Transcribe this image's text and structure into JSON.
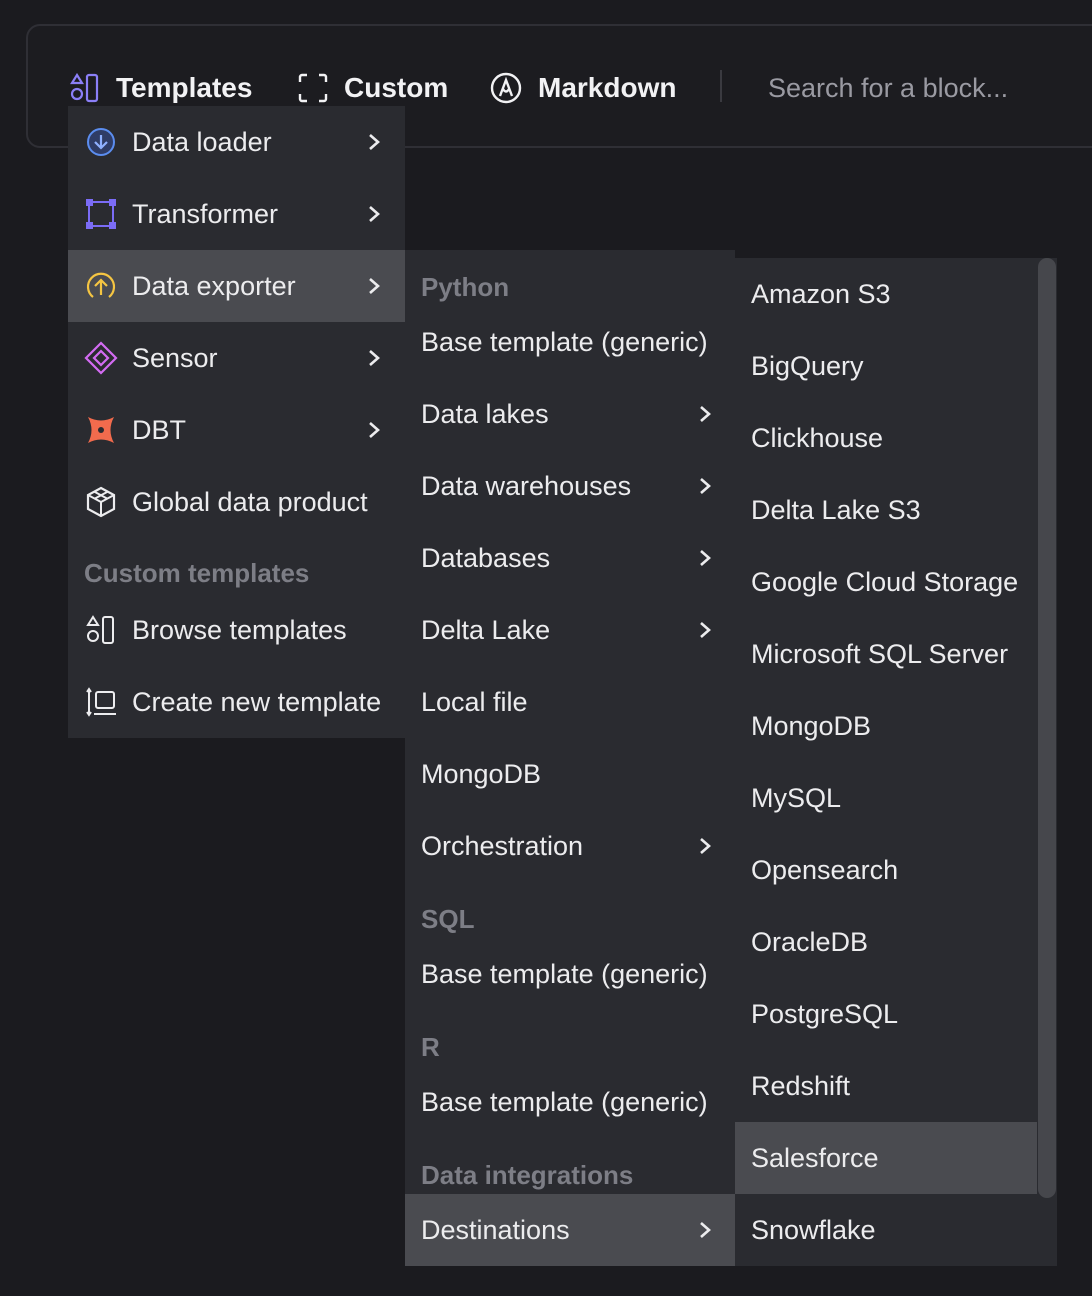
{
  "toolbar": {
    "templates_label": "Templates",
    "custom_label": "Custom",
    "markdown_label": "Markdown",
    "search_placeholder": "Search for a block..."
  },
  "menu1": {
    "items": [
      {
        "label": "Data loader",
        "icon": "data-loader-icon"
      },
      {
        "label": "Transformer",
        "icon": "transformer-icon"
      },
      {
        "label": "Data exporter",
        "icon": "data-exporter-icon"
      },
      {
        "label": "Sensor",
        "icon": "sensor-icon"
      },
      {
        "label": "DBT",
        "icon": "dbt-icon"
      },
      {
        "label": "Global data product",
        "icon": "cube-icon"
      }
    ],
    "custom_header": "Custom templates",
    "browse_label": "Browse templates",
    "create_label": "Create new template"
  },
  "menu2": {
    "python_header": "Python",
    "python_items": [
      "Base template (generic)",
      "Data lakes",
      "Data warehouses",
      "Databases",
      "Delta Lake",
      "Local file",
      "MongoDB",
      "Orchestration"
    ],
    "sql_header": "SQL",
    "sql_item": "Base template (generic)",
    "r_header": "R",
    "r_item": "Base template (generic)",
    "integrations_header": "Data integrations",
    "destinations_label": "Destinations"
  },
  "menu3": {
    "items": [
      "Amazon S3",
      "BigQuery",
      "Clickhouse",
      "Delta Lake S3",
      "Google Cloud Storage",
      "Microsoft SQL Server",
      "MongoDB",
      "MySQL",
      "Opensearch",
      "OracleDB",
      "PostgreSQL",
      "Redshift",
      "Salesforce",
      "Snowflake"
    ]
  },
  "colors": {
    "accent_purple": "#7b6cf6",
    "exporter_yellow": "#f5c542",
    "dbt_orange": "#f26b4d",
    "loader_blue": "#5b8def"
  }
}
